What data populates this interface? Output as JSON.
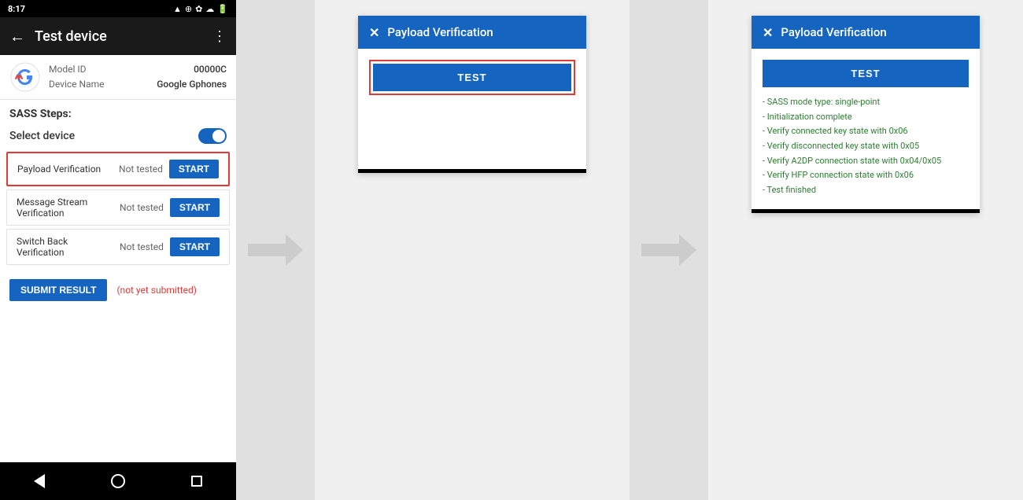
{
  "phone": {
    "status_bar": {
      "time": "8:17",
      "icons_right": "▲ ⊕ ✿ ☁ •"
    },
    "app_bar": {
      "title": "Test device",
      "back_label": "←",
      "menu_label": "⋮"
    },
    "device_info": {
      "model_label": "Model ID",
      "model_value": "00000C",
      "name_label": "Device Name",
      "name_value": "Google Gphones"
    },
    "sass_steps_label": "SASS Steps:",
    "select_device_label": "Select device",
    "test_items": [
      {
        "name": "Payload Verification",
        "status": "Not tested",
        "highlighted": true
      },
      {
        "name": "Message Stream Verification",
        "status": "Not tested",
        "highlighted": false
      },
      {
        "name": "Switch Back Verification",
        "status": "Not tested",
        "highlighted": false
      }
    ],
    "start_label": "START",
    "submit_label": "SUBMIT RESULT",
    "not_submitted_label": "(not yet submitted)",
    "nav": {
      "back": "◀",
      "home": "○",
      "recents": "□"
    }
  },
  "arrow1": {},
  "dialog1": {
    "close_label": "✕",
    "title": "Payload Verification",
    "test_button_label": "TEST"
  },
  "arrow2": {},
  "dialog2": {
    "close_label": "✕",
    "title": "Payload Verification",
    "test_button_label": "TEST",
    "log_lines": [
      "- SASS mode type: single-point",
      "- Initialization complete",
      "- Verify connected key state with 0x06",
      "- Verify disconnected key state with 0x05",
      "- Verify A2DP connection state with 0x04/0x05",
      "- Verify HFP connection state with 0x06",
      "- Test finished"
    ]
  }
}
